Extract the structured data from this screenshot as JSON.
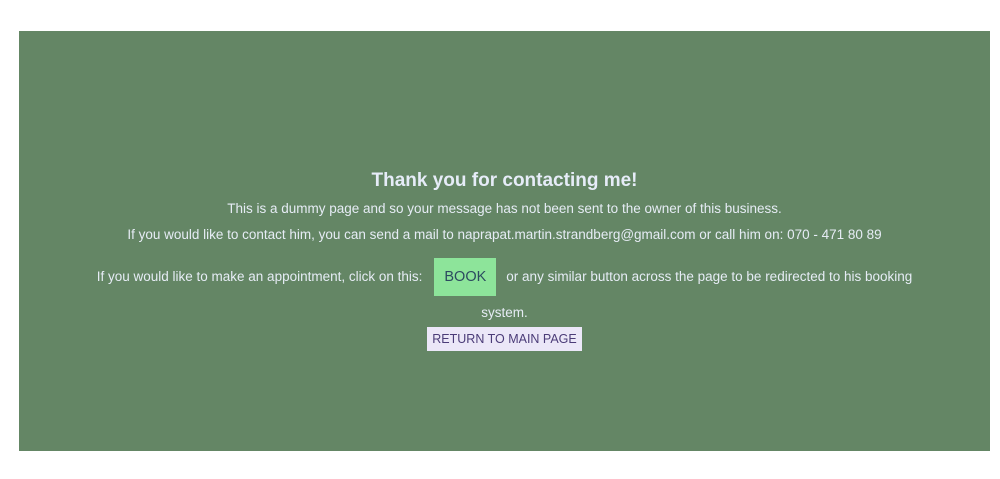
{
  "heading": "Thank you for contacting me!",
  "message": {
    "line1": "This is a dummy page and so your message has not been sent to the owner of this business.",
    "line2": "If you would like to contact him, you can send a mail to naprapat.martin.strandberg@gmail.com or call him on: 070 - 471 80 89"
  },
  "appointment": {
    "prefix": "If you would like to make an appointment, click on this:",
    "book_label": "BOOK",
    "suffix": "or any similar button across the page to be redirected to his booking",
    "continuation": "system."
  },
  "return_label": "RETURN TO MAIN PAGE",
  "colors": {
    "panel_bg": "#648665",
    "book_button_bg": "#8de49a",
    "return_button_bg": "#ebe7f8"
  }
}
